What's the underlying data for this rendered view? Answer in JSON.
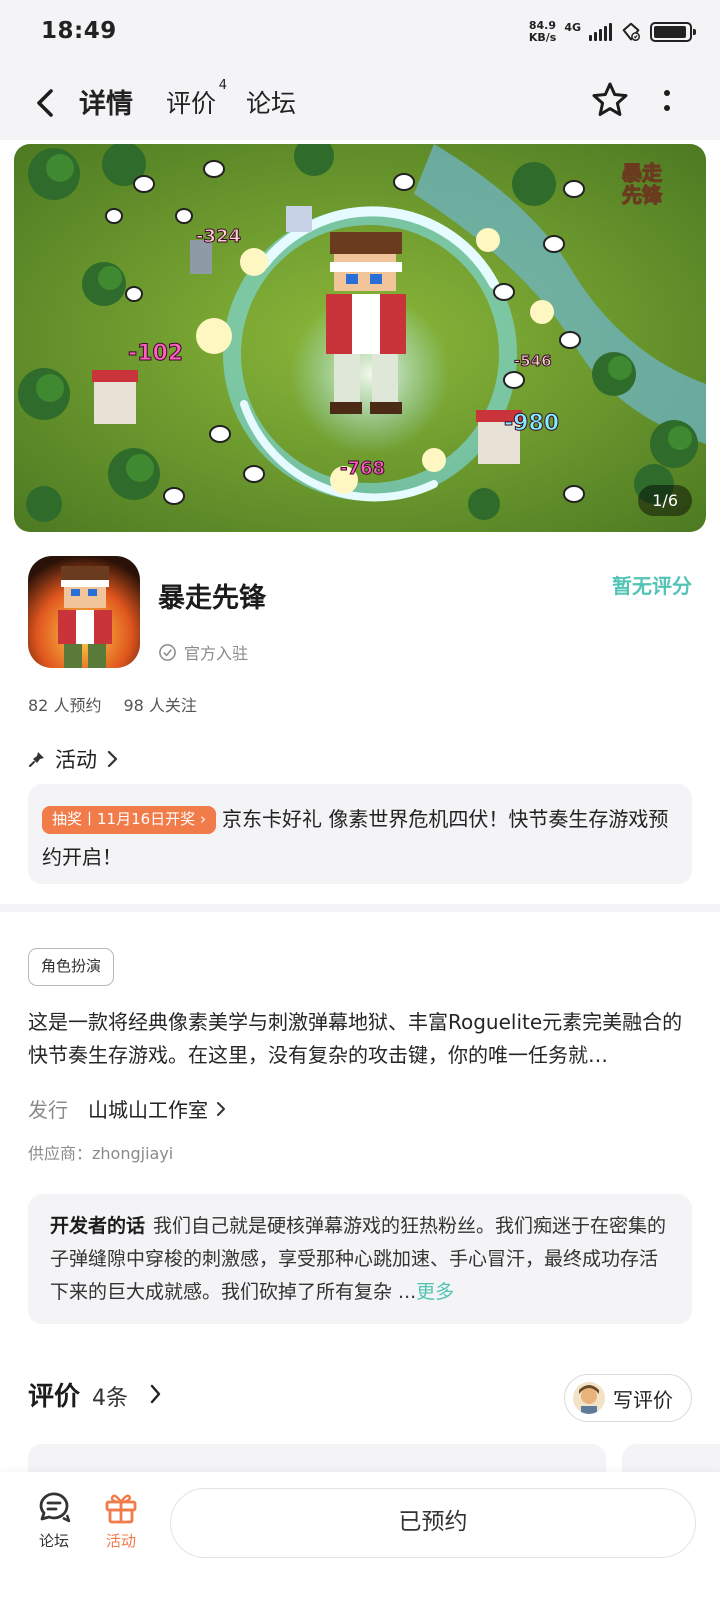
{
  "status_bar": {
    "time": "18:49",
    "net_speed_value": "84.9",
    "net_speed_unit": "KB/s",
    "network": "4G",
    "battery_level": 0.95
  },
  "header": {
    "tabs": [
      {
        "label": "详情",
        "active": true
      },
      {
        "label": "评价",
        "badge": "4"
      },
      {
        "label": "论坛"
      }
    ],
    "icons": [
      "back-icon",
      "star-icon",
      "more-icon"
    ]
  },
  "banner": {
    "counter": "1/6",
    "overlay_title": "暴走\n先锋",
    "damage_numbers": [
      "-324",
      "-102",
      "-546",
      "-980",
      "-768"
    ]
  },
  "game": {
    "name": "暴走先锋",
    "rating_status": "暂无评分",
    "official_label": "官方入驻",
    "reservations": "82 人预约",
    "followers": "98 人关注"
  },
  "activity": {
    "header": "活动",
    "badge": "抽奖丨11月16日开奖",
    "text": "京东卡好礼 像素世界危机四伏！快节奏生存游戏预约开启！"
  },
  "details": {
    "tag": "角色扮演",
    "description": "这是一款将经典像素美学与刺激弹幕地狱、丰富Roguelite元素完美融合的快节奏生存游戏。在这里，没有复杂的攻击键，你的唯一任务就…",
    "publisher_label": "发行",
    "publisher": "山城山工作室",
    "supplier": "供应商：zhongjiayi"
  },
  "developer_note": {
    "title": "开发者的话",
    "text": "我们自己就是硬核弹幕游戏的狂热粉丝。我们痴迷于在密集的子弹缝隙中穿梭的刺激感，享受那种心跳加速、手心冒汗，最终成功存活下来的巨大成就感。我们砍掉了所有复杂 ...",
    "more": "更多"
  },
  "reviews": {
    "title": "评价",
    "count": "4条",
    "write_button": "写评价"
  },
  "bottom_bar": {
    "forum": "论坛",
    "activity": "活动",
    "reserved_button": "已预约"
  },
  "colors": {
    "accent_teal": "#52c3b5",
    "accent_orange": "#f27b4a",
    "background_gray": "#f4f4f6"
  }
}
